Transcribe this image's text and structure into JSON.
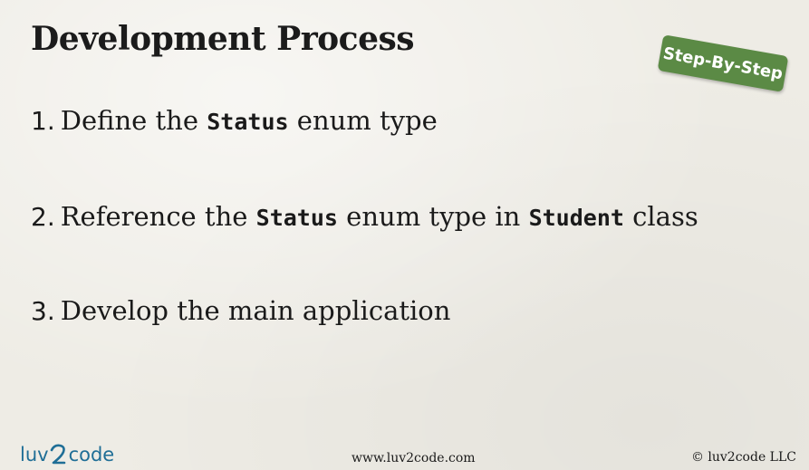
{
  "slide": {
    "title": "Development Process",
    "badge": "Step-By-Step",
    "steps": [
      {
        "number": "1.",
        "parts": [
          "Define the ",
          "Status",
          " enum type"
        ]
      },
      {
        "number": "2.",
        "parts": [
          "Reference the ",
          "Status",
          " enum type in ",
          "Student",
          " class"
        ]
      },
      {
        "number": "3.",
        "parts": [
          "Develop the main application"
        ]
      }
    ]
  },
  "footer": {
    "logo_left": "luv",
    "logo_right": "code",
    "url": "www.luv2code.com",
    "copyright": "© luv2code LLC",
    "colors": {
      "logo": "#1f6e96"
    }
  },
  "colors": {
    "badge": "#5b8a45",
    "background": "#eeece5"
  }
}
